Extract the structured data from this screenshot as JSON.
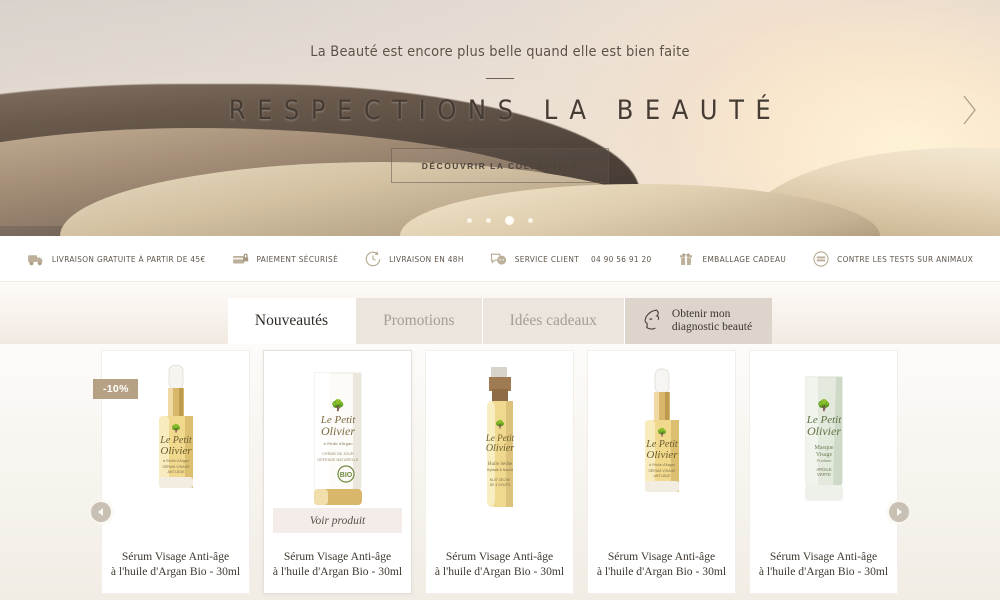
{
  "hero": {
    "subtitle": "La Beauté est encore plus belle quand elle est bien faite",
    "title": "RESPECTIONS LA BEAUTÉ",
    "cta_label": "DÉCOUVRIR LA COLLECTION",
    "prev_icon": "chevron-left-icon",
    "next_icon": "chevron-right-icon",
    "dots": [
      {
        "active": false
      },
      {
        "active": false
      },
      {
        "active": true
      },
      {
        "active": false
      }
    ]
  },
  "service_bar": {
    "items": [
      {
        "icon": "truck-icon",
        "label": "LIVRAISON GRATUITE À PARTIR DE 45€"
      },
      {
        "icon": "card-lock-icon",
        "label": "PAIEMENT SÉCURISÉ"
      },
      {
        "icon": "clock-icon",
        "label": "LIVRAISON EN 48H"
      },
      {
        "icon": "chat-support-icon",
        "label": "SERVICE CLIENT",
        "phone": "04 90 56 91 20"
      },
      {
        "icon": "gift-icon",
        "label": "EMBALLAGE CADEAU"
      },
      {
        "icon": "cruelty-free-stamp-icon",
        "label": "CONTRE LES TESTS SUR ANIMAUX"
      }
    ]
  },
  "tabs": {
    "items": [
      {
        "label": "Nouveautés",
        "active": true
      },
      {
        "label": "Promotions",
        "active": false
      },
      {
        "label": "Idées cadeaux",
        "active": false
      }
    ],
    "diagnostic": {
      "icon": "face-profile-icon",
      "line1": "Obtenir mon",
      "line2": "diagnostic beauté"
    }
  },
  "product_carousel": {
    "prev_icon": "carousel-prev-icon",
    "next_icon": "carousel-next-icon",
    "voir_produit_label": "Voir produit",
    "products": [
      {
        "name_line1": "Sérum Visage Anti-âge",
        "name_line2": "à l'huile d'Argan Bio - 30ml",
        "badge": "-10%",
        "type": "dropper-gold",
        "brand_line1": "Le Petit",
        "brand_line2": "Olivier",
        "sub1": "à l'Huile d'Argan",
        "sub2": "SÉRUM VISAGE",
        "sub3": "ANTI-ÂGE",
        "hovered": false
      },
      {
        "name_line1": "Sérum Visage Anti-âge",
        "name_line2": "à l'huile d'Argan Bio - 30ml",
        "badge": null,
        "type": "tube-white",
        "brand_line1": "Le Petit",
        "brand_line2": "Olivier",
        "sub1": "à l'Huile d'Argan",
        "sub2": "CRÈME DE JOUR",
        "sub3": "DÉFENSE NATURELLE",
        "hovered": true
      },
      {
        "name_line1": "Sérum Visage Anti-âge",
        "name_line2": "à l'huile d'Argan Bio - 30ml",
        "badge": null,
        "type": "spray-gold",
        "brand_line1": "Le Petit",
        "brand_line2": "Olivier",
        "sub1": "Huile Sèche",
        "sub2": "HYDRATE & NOURRIT",
        "sub3": "NUIT SÈCHE DE 4 GOÛTS",
        "hovered": false
      },
      {
        "name_line1": "Sérum Visage Anti-âge",
        "name_line2": "à l'huile d'Argan Bio - 30ml",
        "badge": null,
        "type": "dropper-gold",
        "brand_line1": "Le Petit",
        "brand_line2": "Olivier",
        "sub1": "à l'Huile d'Argan",
        "sub2": "SÉRUM VISAGE",
        "sub3": "ANTI-ÂGE",
        "hovered": false
      },
      {
        "name_line1": "Sérum Visage Anti-âge",
        "name_line2": "à l'huile d'Argan Bio - 30ml",
        "badge": null,
        "type": "tube-green",
        "brand_line1": "Le Petit",
        "brand_line2": "Olivier",
        "sub1": "Masque Visage",
        "sub2": "PURIFIANT",
        "sub3": "ARGILE VERTE",
        "hovered": false
      }
    ]
  },
  "colors": {
    "badge_bg": "#b6a184",
    "tab_active_bg": "#ffffff",
    "tab_inactive_bg": "#ece5de",
    "diagnostic_bg": "#ddd5cc",
    "service_icon": "#b6a991",
    "hero_title": "#463c33"
  }
}
